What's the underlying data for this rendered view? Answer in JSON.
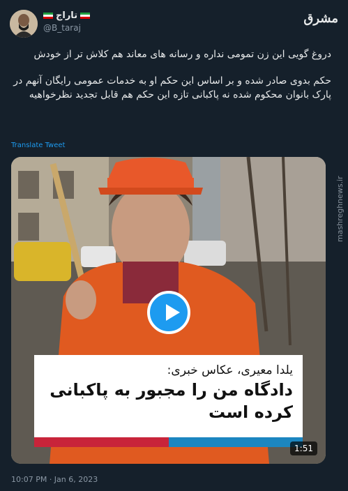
{
  "author": {
    "display_name": "تاراج",
    "handle": "@B_taraj"
  },
  "site_logo": "مشرق",
  "watermark": "mashreghnews.ir",
  "tweet": {
    "paragraph_1": "دروغ گویی این زن تمومی نداره و رسانه های معاند هم کلاش تر از خودش",
    "paragraph_2": "حکم بدوی صادر شده و بر اساس این حکم او به خدمات عمومی رایگان آنهم در پارک بانوان محکوم شده نه پاکبانی تازه این حکم هم قابل تجدید نظرخواهیه",
    "translate_label": "Translate Tweet"
  },
  "video": {
    "caption_name": "یلدا معیری، عکاس خبری:",
    "caption_quote": "دادگاه من را مجبور به پاکبانی کرده است",
    "duration": "1:51"
  },
  "timestamp": "10:07 PM · Jan 6, 2023",
  "colors": {
    "background": "#15202b",
    "link": "#1d9bf0",
    "bar_red": "#c8243a",
    "bar_blue": "#1c86c0"
  }
}
